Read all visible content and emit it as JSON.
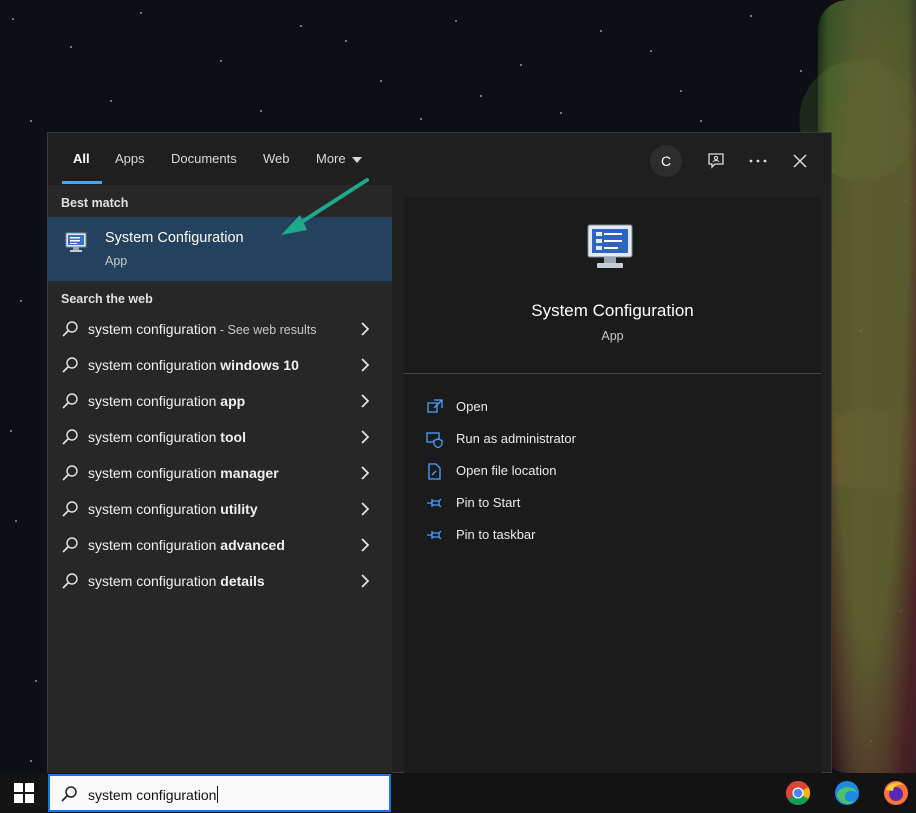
{
  "tabs": [
    {
      "label": "All"
    },
    {
      "label": "Apps"
    },
    {
      "label": "Documents"
    },
    {
      "label": "Web"
    },
    {
      "label": "More"
    }
  ],
  "header": {
    "avatar_letter": "C",
    "more_icon": "ellipsis-icon",
    "close_icon": "close-icon",
    "feedback_icon": "feedback-icon"
  },
  "best_match": {
    "section_title": "Best match",
    "title": "System Configuration",
    "subtitle": "App",
    "icon": "system-configuration-icon"
  },
  "search_web": {
    "section_title": "Search the web",
    "items": [
      {
        "base": "system configuration",
        "bold": "",
        "hint": " - See web results"
      },
      {
        "base": "system configuration ",
        "bold": "windows 10",
        "hint": ""
      },
      {
        "base": "system configuration ",
        "bold": "app",
        "hint": ""
      },
      {
        "base": "system configuration ",
        "bold": "tool",
        "hint": ""
      },
      {
        "base": "system configuration ",
        "bold": "manager",
        "hint": ""
      },
      {
        "base": "system configuration ",
        "bold": "utility",
        "hint": ""
      },
      {
        "base": "system configuration ",
        "bold": "advanced",
        "hint": ""
      },
      {
        "base": "system configuration ",
        "bold": "details",
        "hint": ""
      }
    ]
  },
  "detail": {
    "title": "System Configuration",
    "subtitle": "App",
    "actions": [
      {
        "label": "Open",
        "icon": "open-icon"
      },
      {
        "label": "Run as administrator",
        "icon": "shield-icon"
      },
      {
        "label": "Open file location",
        "icon": "file-location-icon"
      },
      {
        "label": "Pin to Start",
        "icon": "pin-icon"
      },
      {
        "label": "Pin to taskbar",
        "icon": "pin-icon"
      }
    ]
  },
  "taskbar": {
    "search_value": "system configuration",
    "apps": [
      "chrome-icon",
      "edge-icon",
      "firefox-icon"
    ]
  },
  "colors": {
    "accent": "#4aa3ff",
    "selection": "#24425e",
    "annotation_arrow": "#1fa98a",
    "search_border": "#1a73e8"
  }
}
